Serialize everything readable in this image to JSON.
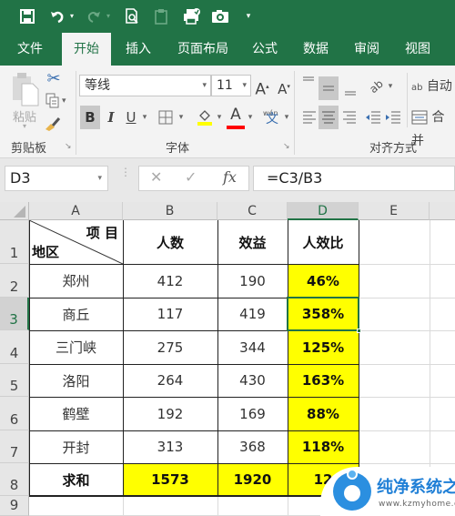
{
  "quick_access": {
    "save_icon": "save-icon",
    "undo_icon": "undo-icon",
    "redo_icon": "redo-icon",
    "print_preview_icon": "print-preview-icon",
    "clipboard_icon": "clipboard-icon",
    "print_icon": "print-icon",
    "camera_icon": "camera-icon",
    "customize_icon": "customize-quick-access-icon"
  },
  "tabs": [
    {
      "label": "文件"
    },
    {
      "label": "开始",
      "active": true
    },
    {
      "label": "插入"
    },
    {
      "label": "页面布局"
    },
    {
      "label": "公式"
    },
    {
      "label": "数据"
    },
    {
      "label": "审阅"
    },
    {
      "label": "视图"
    }
  ],
  "ribbon": {
    "clipboard": {
      "paste_label": "粘贴",
      "group_label": "剪贴板"
    },
    "font": {
      "font_name": "等线",
      "font_size": "11",
      "bold": "B",
      "italic": "I",
      "underline": "U",
      "grow": "A",
      "shrink": "A",
      "font_color_glyph": "A",
      "phonetic_top": "wén",
      "phonetic_glyph": "文",
      "group_label": "字体",
      "fill_color": "#ffff00",
      "font_color": "#ff0000"
    },
    "alignment": {
      "wrap_label": "自动",
      "merge_label": "合并",
      "wrap_icon_text": "ab",
      "group_label": "对齐方式"
    }
  },
  "formula_bar": {
    "name_box": "D3",
    "cancel": "✕",
    "enter": "✓",
    "fx": "fx",
    "formula": "=C3/B3"
  },
  "sheet": {
    "columns": [
      "A",
      "B",
      "C",
      "D",
      "E"
    ],
    "selected_column": "D",
    "selected_row": "3",
    "rows": [
      "1",
      "2",
      "3",
      "4",
      "5",
      "6",
      "7",
      "8",
      "9"
    ],
    "header_cell": {
      "top_right": "项 目",
      "bottom_left": "地区"
    },
    "headers": [
      "人数",
      "效益",
      "人效比"
    ],
    "data": [
      {
        "region": "郑州",
        "people": "412",
        "benefit": "190",
        "ratio": "46%"
      },
      {
        "region": "商丘",
        "people": "117",
        "benefit": "419",
        "ratio": "358%"
      },
      {
        "region": "三门峡",
        "people": "275",
        "benefit": "344",
        "ratio": "125%"
      },
      {
        "region": "洛阳",
        "people": "264",
        "benefit": "430",
        "ratio": "163%"
      },
      {
        "region": "鹤壁",
        "people": "192",
        "benefit": "169",
        "ratio": "88%"
      },
      {
        "region": "开封",
        "people": "313",
        "benefit": "368",
        "ratio": "118%"
      }
    ],
    "total": {
      "label": "求和",
      "people": "1573",
      "benefit": "1920",
      "ratio_partial": "12"
    },
    "highlight_color": "#ffff00",
    "accent_color": "#217346"
  },
  "watermark": {
    "title": "纯净系统之家",
    "url": "www.kzmyhome.com"
  }
}
